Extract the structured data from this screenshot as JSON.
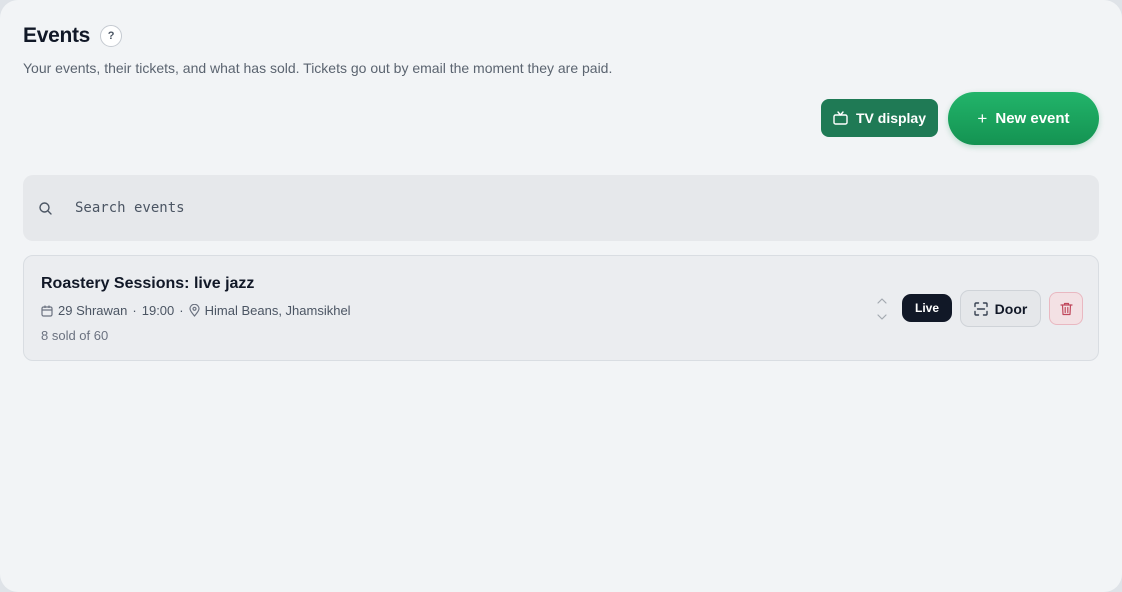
{
  "header": {
    "title": "Events",
    "help_label": "?",
    "subtitle": "Your events, their tickets, and what has sold. Tickets go out by email the moment they are paid."
  },
  "actions": {
    "tv_display_label": "TV display",
    "new_event_plus": "+",
    "new_event_label": "New event"
  },
  "search": {
    "placeholder": "Search events"
  },
  "events": [
    {
      "name": "Roastery Sessions: live jazz",
      "date": "29 Shrawan",
      "sep1": "·",
      "time": "19:00",
      "sep2": "·",
      "venue": "Himal Beans, Jhamsikhel",
      "sold": "8 sold of 60",
      "status": "Live",
      "door_label": "Door"
    }
  ],
  "colors": {
    "accent_green": "#149352",
    "tv_green": "#1f7a55",
    "badge_dark": "#111827",
    "danger": "#c0485c"
  },
  "icons": {
    "help": "question-icon",
    "tv": "tv-icon",
    "search": "search-icon",
    "calendar": "calendar-icon",
    "location": "map-pin-icon",
    "reorder": "reorder-arrows-icon",
    "door": "scan-icon",
    "delete": "trash-icon"
  }
}
